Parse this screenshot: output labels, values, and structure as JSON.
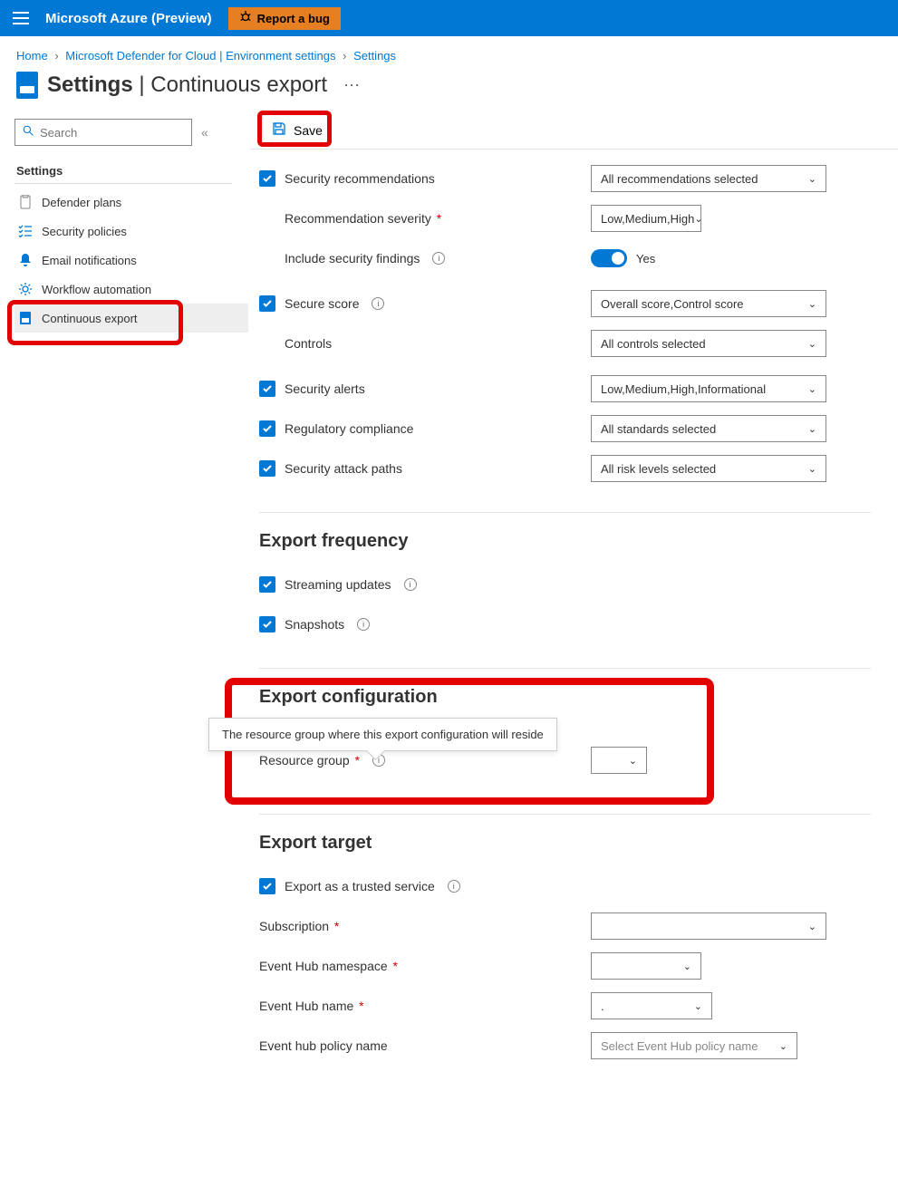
{
  "topbar": {
    "brand": "Microsoft Azure (Preview)",
    "bug_label": "Report a bug"
  },
  "breadcrumb": {
    "items": [
      "Home",
      "Microsoft Defender for Cloud | Environment settings",
      "Settings"
    ]
  },
  "title": {
    "main": "Settings",
    "sub": "Continuous export"
  },
  "sidebar": {
    "search_placeholder": "Search",
    "heading": "Settings",
    "items": [
      {
        "label": "Defender plans"
      },
      {
        "label": "Security policies"
      },
      {
        "label": "Email notifications"
      },
      {
        "label": "Workflow automation"
      },
      {
        "label": "Continuous export"
      }
    ]
  },
  "toolbar": {
    "save_label": "Save"
  },
  "form": {
    "sec_rec_label": "Security recommendations",
    "sec_rec_dd": "All recommendations selected",
    "rec_sev_label": "Recommendation severity",
    "rec_sev_dd": "Low,Medium,High",
    "incl_findings_label": "Include security findings",
    "incl_findings_val": "Yes",
    "secure_score_label": "Secure score",
    "secure_score_dd": "Overall score,Control score",
    "controls_label": "Controls",
    "controls_dd": "All controls selected",
    "alerts_label": "Security alerts",
    "alerts_dd": "Low,Medium,High,Informational",
    "reg_comp_label": "Regulatory compliance",
    "reg_comp_dd": "All standards selected",
    "attack_paths_label": "Security attack paths",
    "attack_paths_dd": "All risk levels selected"
  },
  "freq": {
    "heading": "Export frequency",
    "stream_label": "Streaming updates",
    "snap_label": "Snapshots"
  },
  "config": {
    "heading": "Export configuration",
    "rg_label": "Resource group",
    "tooltip": "The resource group where this export configuration will reside"
  },
  "target": {
    "heading": "Export target",
    "trusted_label": "Export as a trusted service",
    "sub_label": "Subscription",
    "ns_label": "Event Hub namespace",
    "name_label": "Event Hub name",
    "policy_label": "Event hub policy name",
    "policy_ph": "Select Event Hub policy name"
  }
}
